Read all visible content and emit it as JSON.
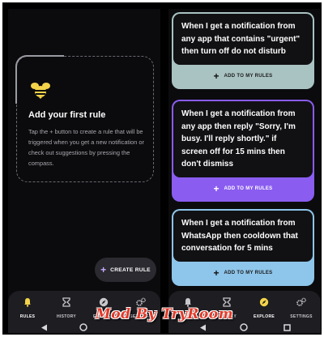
{
  "left_screen": {
    "empty_state": {
      "title": "Add your first rule",
      "description": "Tap the + button to create a rule that will be triggered when you get a new notification or check out suggestions by pressing the compass."
    },
    "fab": {
      "icon": "plus-icon",
      "label": "CREATE RULE"
    },
    "nav": [
      {
        "label": "RULES",
        "icon": "bell-icon",
        "active": true
      },
      {
        "label": "HISTORY",
        "icon": "history-icon",
        "active": false
      },
      {
        "label": "EXPLORE",
        "icon": "compass-icon",
        "active": false
      },
      {
        "label": "SETTINGS",
        "icon": "gears-icon",
        "active": false
      }
    ]
  },
  "right_screen": {
    "rules": [
      {
        "text": "When I get a notification from any app that contains \"urgent\" then turn off do not disturb",
        "action": "ADD TO MY RULES",
        "color": "#a9c3c2"
      },
      {
        "text": "When I get a notification from any app then reply \"Sorry, I'm busy. I'll reply shortly.\" if screen off for 15 mins then don't dismiss",
        "action": "ADD TO MY RULES",
        "color": "#8a5cf0"
      },
      {
        "text": "When I get a notification from WhatsApp then cooldown that conversation for 5 mins",
        "action": "ADD TO MY RULES",
        "color": "#8ec5ea"
      }
    ],
    "nav": [
      {
        "label": "RULES",
        "icon": "bell-icon",
        "active": false
      },
      {
        "label": "HISTORY",
        "icon": "history-icon",
        "active": false
      },
      {
        "label": "EXPLORE",
        "icon": "compass-icon",
        "active": true
      },
      {
        "label": "SETTINGS",
        "icon": "gears-icon",
        "active": false
      }
    ]
  },
  "colors": {
    "accent_yellow": "#f4d34a",
    "accent_purple": "#c8a9ff",
    "watermark_red": "#e23a2a"
  },
  "watermark": "Mod By TryRoom"
}
